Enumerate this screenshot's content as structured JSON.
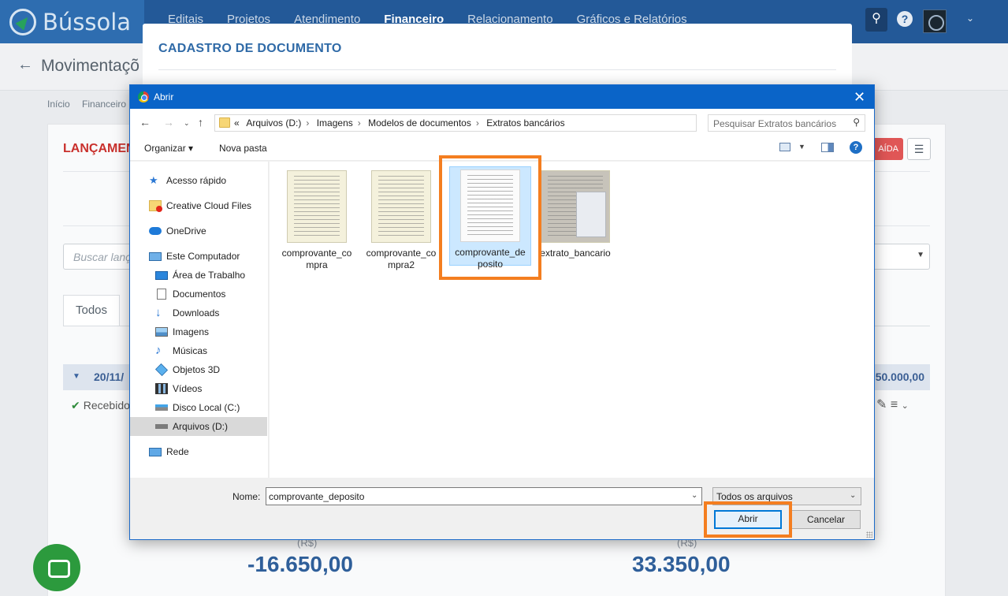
{
  "app": {
    "logo_text": "Bússola",
    "nav": [
      "Editais",
      "Projetos",
      "Atendimento",
      "Financeiro",
      "Relacionamento",
      "Gráficos e Relatórios"
    ],
    "active_nav": "Financeiro",
    "page_title": "Movimentaçõ",
    "breadcrumb": [
      "Início",
      "Financeiro"
    ],
    "section_title": "LANÇAMEN",
    "red_button_text": "AÍDA",
    "search_placeholder": "Buscar lanç",
    "tab_all": "Todos",
    "group_date": "20/11/",
    "group_total": "50.000,00",
    "status_text": "Recebido",
    "currency_label": "(R$)",
    "value_left": "-16.650,00",
    "value_right": "33.350,00",
    "colors": {
      "primary": "#235998",
      "accent_red": "#c9302c",
      "success": "#2c9a3d"
    }
  },
  "cadastro_modal": {
    "title": "CADASTRO DE DOCUMENTO"
  },
  "dialog": {
    "title": "Abrir",
    "address": {
      "prefix": "«",
      "segments": [
        "Arquivos (D:)",
        "Imagens",
        "Modelos de documentos",
        "Extratos bancários"
      ]
    },
    "search_placeholder": "Pesquisar Extratos bancários",
    "toolbar": {
      "organizar": "Organizar",
      "nova_pasta": "Nova pasta",
      "help": "?"
    },
    "nav_items": [
      {
        "label": "Acesso rápido",
        "icon": "star-icon"
      },
      {
        "label": "Creative Cloud Files",
        "icon": "creative-cloud-icon"
      },
      {
        "label": "OneDrive",
        "icon": "cloud-icon"
      },
      {
        "label": "Este Computador",
        "icon": "computer-icon"
      },
      {
        "label": "Área de Trabalho",
        "icon": "desktop-icon"
      },
      {
        "label": "Documentos",
        "icon": "documents-icon"
      },
      {
        "label": "Downloads",
        "icon": "download-icon"
      },
      {
        "label": "Imagens",
        "icon": "pictures-icon"
      },
      {
        "label": "Músicas",
        "icon": "music-icon"
      },
      {
        "label": "Objetos 3D",
        "icon": "cube-icon"
      },
      {
        "label": "Vídeos",
        "icon": "video-icon"
      },
      {
        "label": "Disco Local (C:)",
        "icon": "drive-icon"
      },
      {
        "label": "Arquivos (D:)",
        "icon": "drive-icon"
      },
      {
        "label": "Rede",
        "icon": "network-icon"
      }
    ],
    "selected_nav": "Arquivos (D:)",
    "files": [
      {
        "name": "comprovante_compra"
      },
      {
        "name": "comprovante_compra2"
      },
      {
        "name": "comprovante_deposito"
      },
      {
        "name": "extrato_bancario"
      }
    ],
    "selected_file": "comprovante_deposito",
    "filename_label": "Nome:",
    "filename_value": "comprovante_deposito",
    "filetype": "Todos os arquivos",
    "open_button": "Abrir",
    "cancel_button": "Cancelar"
  }
}
